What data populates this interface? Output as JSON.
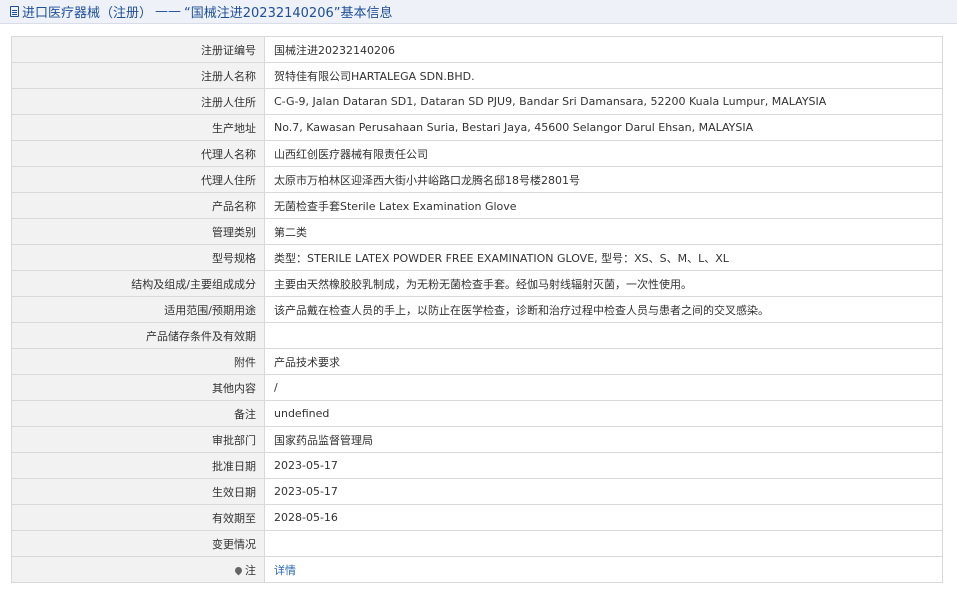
{
  "header": {
    "title_prefix": "进口医疗器械（注册）",
    "separator": "——",
    "title_main": "“国械注进20232140206”基本信息"
  },
  "rows": [
    {
      "label": "注册证编号",
      "value": "国械注进20232140206"
    },
    {
      "label": "注册人名称",
      "value": "贺特佳有限公司HARTALEGA SDN.BHD."
    },
    {
      "label": "注册人住所",
      "value": "C-G-9, Jalan Dataran SD1, Dataran SD PJU9, Bandar Sri Damansara, 52200 Kuala Lumpur, MALAYSIA"
    },
    {
      "label": "生产地址",
      "value": "No.7, Kawasan Perusahaan Suria, Bestari Jaya, 45600 Selangor Darul Ehsan, MALAYSIA"
    },
    {
      "label": "代理人名称",
      "value": "山西红创医疗器械有限责任公司"
    },
    {
      "label": "代理人住所",
      "value": "太原市万柏林区迎泽西大街小井峪路口龙腾名邸18号楼2801号"
    },
    {
      "label": "产品名称",
      "value": "无菌检查手套Sterile Latex Examination Glove"
    },
    {
      "label": "管理类别",
      "value": "第二类"
    },
    {
      "label": "型号规格",
      "value": "类型：STERILE LATEX POWDER FREE EXAMINATION GLOVE, 型号：XS、S、M、L、XL"
    },
    {
      "label": "结构及组成/主要组成成分",
      "value": "主要由天然橡胶胶乳制成，为无粉无菌检查手套。经伽马射线辐射灭菌，一次性使用。"
    },
    {
      "label": "适用范围/预期用途",
      "value": "该产品戴在检查人员的手上，以防止在医学检查，诊断和治疗过程中检查人员与患者之间的交叉感染。"
    },
    {
      "label": "产品储存条件及有效期",
      "value": ""
    },
    {
      "label": "附件",
      "value": "产品技术要求"
    },
    {
      "label": "其他内容",
      "value": "/"
    },
    {
      "label": "备注",
      "value": "undefined"
    },
    {
      "label": "审批部门",
      "value": "国家药品监督管理局"
    },
    {
      "label": "批准日期",
      "value": "2023-05-17"
    },
    {
      "label": "生效日期",
      "value": "2023-05-17"
    },
    {
      "label": "有效期至",
      "value": "2028-05-16"
    },
    {
      "label": "变更情况",
      "value": ""
    }
  ],
  "note_row": {
    "label": "注",
    "link_text": "详情",
    "icon": "pin-icon"
  },
  "colors": {
    "header_text": "#1e4f9a",
    "header_bg": "#eef1f7",
    "label_bg": "#f2f2f2",
    "border": "#d9d9d9",
    "link": "#2a68b4"
  }
}
